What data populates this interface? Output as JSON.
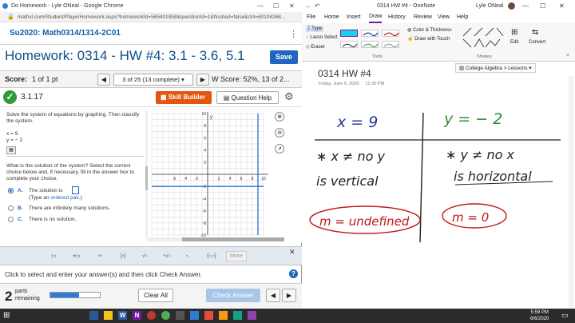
{
  "browser": {
    "tab_title": "Do Homework - Lyle ONeal - Google Chrome",
    "url": "mathxl.com/Student/PlayerHomework.aspx?homeworkId=565401858&questionId=1&flushed=false&cId=60104268..."
  },
  "mathxl": {
    "course_title": "Su2020: Math0314/1314-2C01",
    "hw_title": "Homework: 0314 - HW #4: 3.1 - 3.6, 5.1",
    "save_label": "Save",
    "score_label": "Score:",
    "score_value": "1 of 1 pt",
    "question_nav": "3 of 25 (13 complete)",
    "hw_score": "W Score: 52%, 13 of 2...",
    "question_number": "3.1.17",
    "skill_builder": "Skill Builder",
    "question_help": "Question Help",
    "question_text": "Solve the system of equations by graphing. Then classify the system.",
    "eq1": "x = 9",
    "eq2": "y = − 2",
    "prompt": "What is the solution of the system? Select the correct choice below and, if necessary, fill in the answer box to complete your choice.",
    "choice_a_letter": "A.",
    "choice_a_text": "The solution is",
    "choice_a_hint_prefix": "(Type an",
    "choice_a_hint_link": "ordered pair",
    "choice_a_hint_suffix": ".)",
    "choice_b_letter": "B.",
    "choice_b_text": "There are infinitely many solutions.",
    "choice_c_letter": "C.",
    "choice_c_text": "There is no solution.",
    "toolbar_more": "More",
    "hint": "Click to select and enter your answer(s) and then click Check Answer.",
    "parts_count": "2",
    "parts_label": "parts",
    "remaining_label": "remaining",
    "clear_all": "Clear All",
    "check_answer": "Check Answer",
    "graph": {
      "y_axis_label": "y",
      "x_ticks": [
        "-6",
        "-4",
        "-2",
        "2",
        "4",
        "6",
        "8",
        "10"
      ],
      "y_ticks": [
        "10",
        "8",
        "6",
        "4",
        "2",
        "-2",
        "-4",
        "-6",
        "-8",
        "-10"
      ]
    }
  },
  "onenote": {
    "window_title": "0314 HW #4 - OneNote",
    "user": "Lyle ONeal",
    "menu": [
      "File",
      "Home",
      "Insert",
      "Draw",
      "History",
      "Review",
      "View",
      "Help"
    ],
    "active_menu": "Draw",
    "ribbon": {
      "type_label": "Type",
      "lasso": "Lasso Select",
      "eraser": "Eraser",
      "tools_group": "Tools",
      "color_thickness": "Color & Thickness",
      "draw_touch": "Draw with Touch",
      "shapes_group": "Shapes",
      "edit": "Edit",
      "convert": "Convert"
    },
    "notebook_path": "College Algebra > Lessons",
    "page_title": "0314 HW #4",
    "page_date": "Friday, June 5, 2020",
    "page_time": "12:30 PM",
    "ink": {
      "left_eq": "x = 9",
      "right_eq": "y = − 2",
      "left_note_1": "∗ x ≠ no y",
      "left_note_2": "is vertical",
      "right_note_1": "∗ y ≠ no x",
      "right_note_2": "is horizontal",
      "left_slope": "m = undefined",
      "right_slope": "m = 0"
    }
  },
  "taskbar": {
    "time": "5:59 PM",
    "date": "6/6/2020"
  },
  "colors": {
    "mathxl_blue": "#1f66c0",
    "skill_orange": "#e2570f",
    "ink_blue": "#2a3a9c",
    "ink_green": "#2f8a3a",
    "ink_red": "#c21818"
  }
}
